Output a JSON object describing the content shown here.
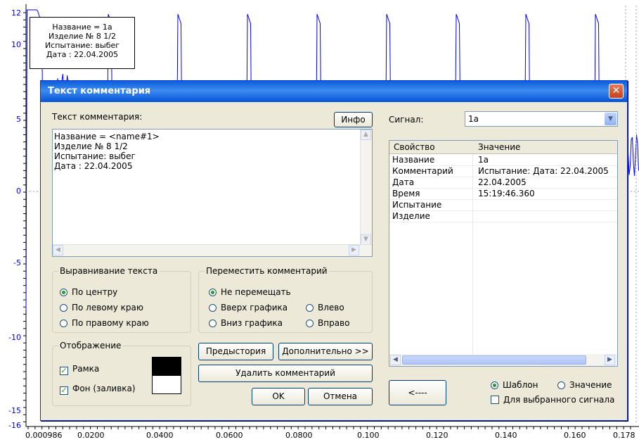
{
  "chart": {
    "y_ticks": [
      "12",
      "10",
      "5",
      "0",
      "-5",
      "-10",
      "-15",
      "-16"
    ],
    "x_ticks": [
      "0.000986",
      "0.0200",
      "0.0400",
      "0.0600",
      "0.0800",
      "0.100",
      "0.120",
      "0.140",
      "0.160",
      "0.178"
    ],
    "colors": {
      "axis_text": "#0000ff",
      "signal": "#0000ff"
    },
    "legend_lines": [
      "Название = 1а",
      "Изделие № 8 1/2",
      "Испытание: выбег",
      "Дата : 22.04.2005"
    ]
  },
  "dialog": {
    "title": "Текст комментария",
    "close_label": "✕",
    "comment_label": "Текст комментария:",
    "info_button": "Инфо",
    "comment_lines": [
      "Название = <name#1>",
      "Изделие № 8 1/2",
      "Испытание: выбег",
      "Дата : 22.04.2005"
    ],
    "align_group": {
      "title": "Выравнивание текста",
      "options": [
        "По центру",
        "По левому краю",
        "По правому краю"
      ],
      "selected": "По центру"
    },
    "move_group": {
      "title": "Переместить комментарий",
      "options": [
        "Не перемещать",
        "Вверх графика",
        "Влево",
        "Вниз графика",
        "Вправо"
      ],
      "selected": "Не перемещать"
    },
    "display_group": {
      "title": "Отображение",
      "frame_label": "Рамка",
      "fill_label": "Фон (заливка)",
      "frame_checked": true,
      "fill_checked": true
    },
    "buttons": {
      "prehistory": "Предыстория",
      "advanced": "Дополнительно >>",
      "delete": "Удалить комментарий",
      "ok": "OK",
      "cancel": "Отмена",
      "back": "<----"
    },
    "signal_label": "Сигнал:",
    "signal_value": "1а",
    "grid": {
      "headers": [
        "Свойство",
        "Значение"
      ],
      "rows": [
        [
          "Название",
          "1а"
        ],
        [
          "Комментарий",
          "Испытание: Дата: 22.04.2005"
        ],
        [
          "Дата",
          "22.04.2005"
        ],
        [
          "Время",
          "15:19:46.360"
        ],
        [
          "Испытание",
          ""
        ],
        [
          "Изделие",
          ""
        ]
      ]
    },
    "mode": {
      "template_label": "Шаблон",
      "value_label": "Значение",
      "selected": "Шаблон",
      "selected_signal_label": "Для выбранного сигнала",
      "selected_signal_checked": false
    }
  }
}
